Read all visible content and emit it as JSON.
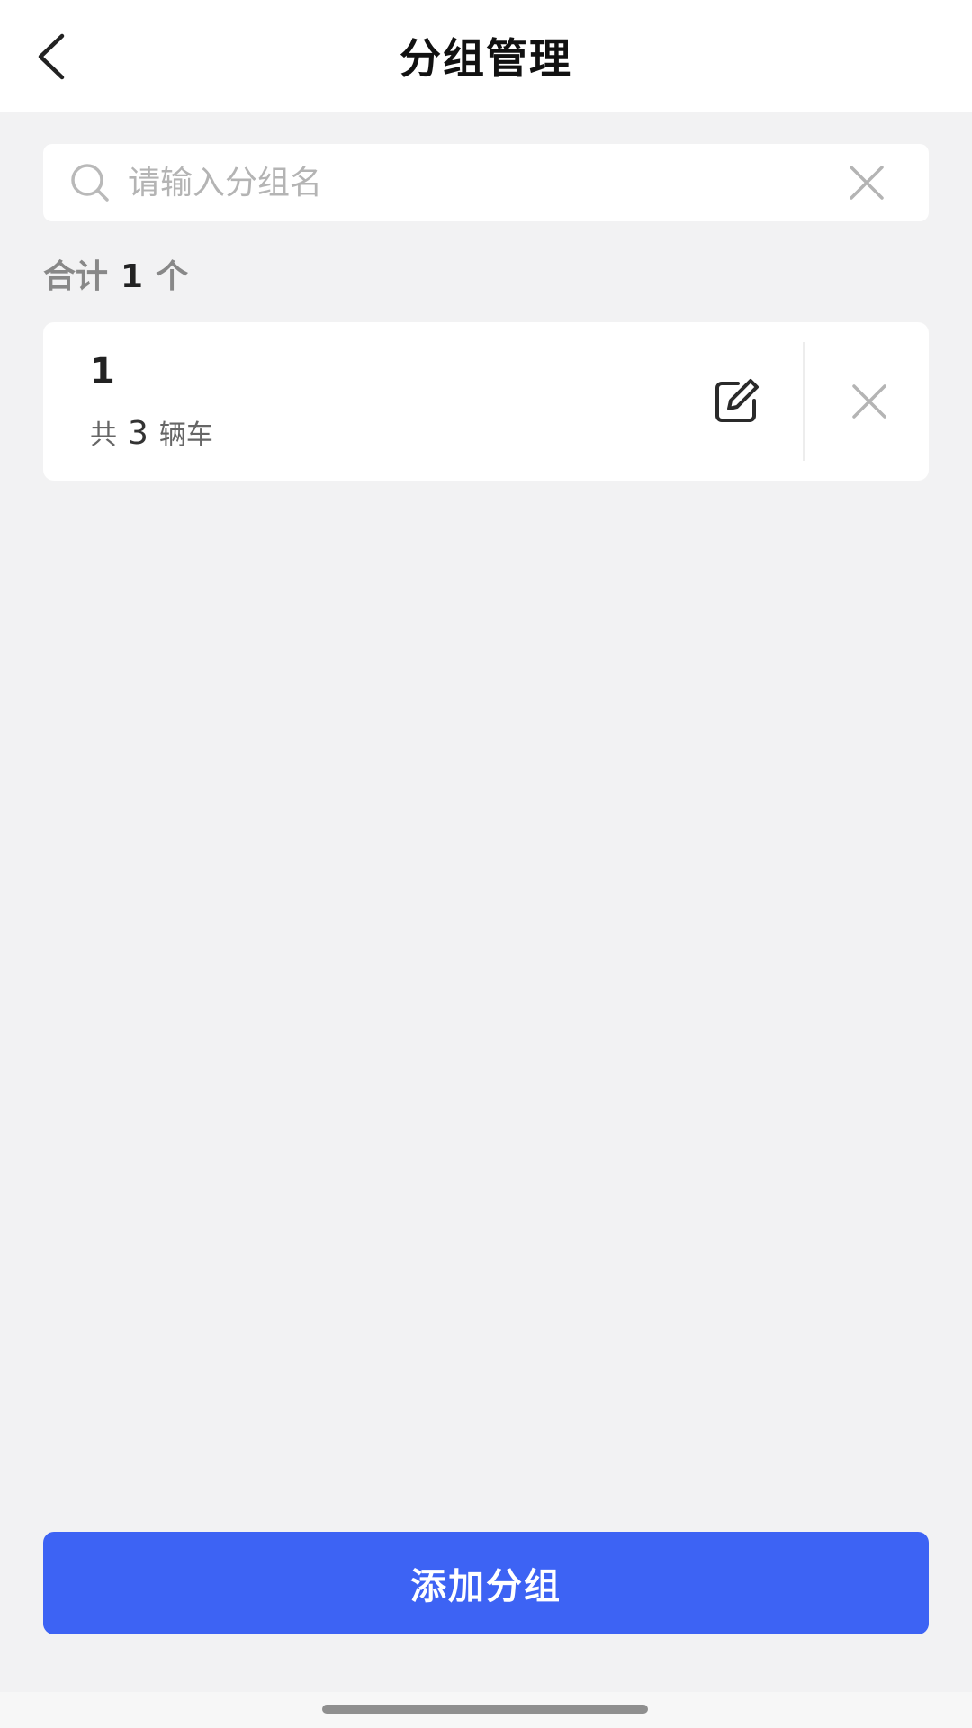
{
  "header": {
    "title": "分组管理",
    "back_icon": "chevron-left-icon"
  },
  "search": {
    "placeholder": "请输入分组名",
    "value": "",
    "search_icon": "search-icon",
    "clear_icon": "close-icon"
  },
  "summary": {
    "prefix": "合计",
    "count": "1",
    "suffix": "个"
  },
  "groups": [
    {
      "name": "1",
      "vehicles_prefix": "共",
      "vehicles_count": "3",
      "vehicles_suffix": "辆车",
      "edit_icon": "edit-icon",
      "delete_icon": "close-icon"
    }
  ],
  "footer": {
    "add_button_label": "添加分组"
  },
  "colors": {
    "primary": "#3d63f4",
    "background": "#f2f2f3",
    "card": "#ffffff"
  }
}
